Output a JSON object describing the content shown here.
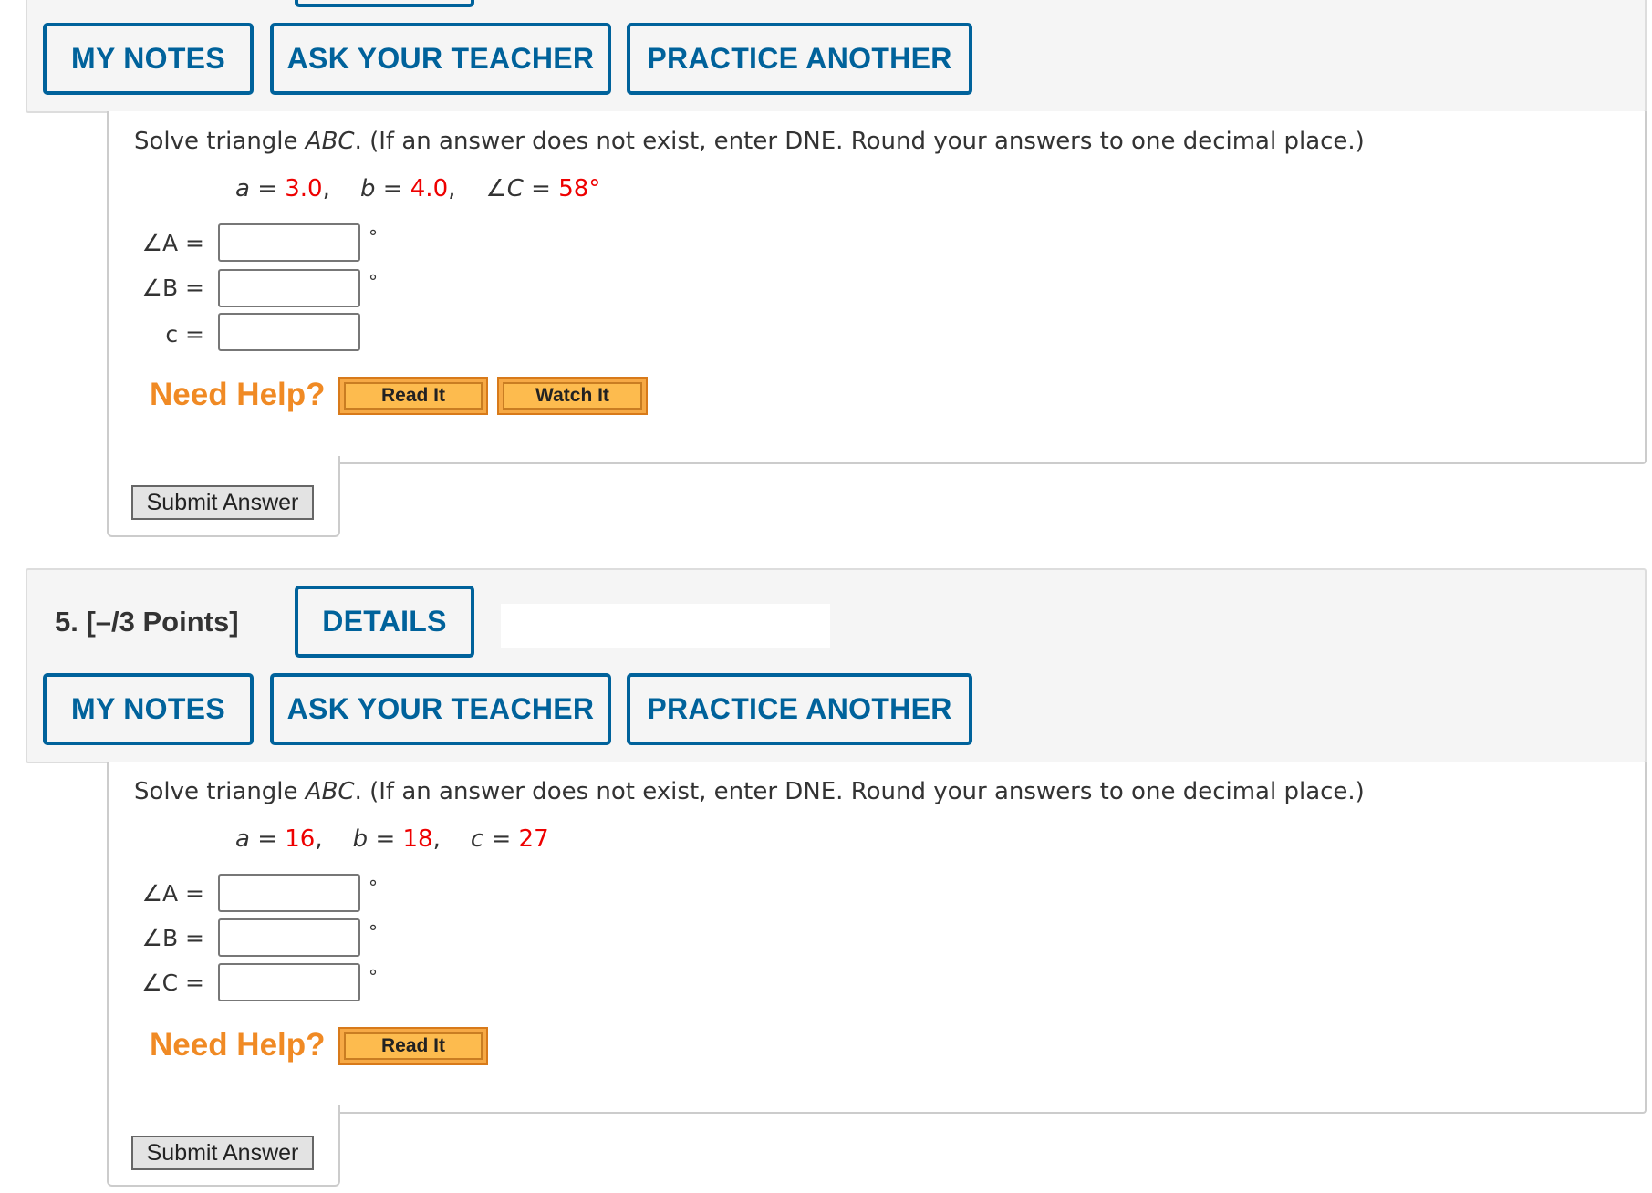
{
  "buttons": {
    "my_notes": "MY NOTES",
    "ask_teacher": "ASK YOUR TEACHER",
    "practice_another": "PRACTICE ANOTHER",
    "details": "DETAILS",
    "submit": "Submit Answer",
    "read_it": "Read It",
    "watch_it": "Watch It",
    "need_help": "Need Help?"
  },
  "q4": {
    "instruction_pre": "Solve triangle ",
    "instruction_abc": "ABC",
    "instruction_post": ". (If an answer does not exist, enter DNE. Round your answers to one decimal place.)",
    "given": [
      {
        "label": "a = ",
        "value": "3.0",
        "sep": ","
      },
      {
        "label": "b = ",
        "value": "4.0",
        "sep": ","
      },
      {
        "label": "∠C = ",
        "value": "58°",
        "sep": ""
      }
    ],
    "answers": [
      {
        "label": "∠A =",
        "unit": "°",
        "value": ""
      },
      {
        "label": "∠B =",
        "unit": "°",
        "value": ""
      },
      {
        "label": "c =",
        "unit": "",
        "value": ""
      }
    ]
  },
  "q5": {
    "title": "5.  [–/3 Points]",
    "instruction_pre": "Solve triangle ",
    "instruction_abc": "ABC",
    "instruction_post": ". (If an answer does not exist, enter DNE. Round your answers to one decimal place.)",
    "given": [
      {
        "label": "a = ",
        "value": "16",
        "sep": ","
      },
      {
        "label": "b = ",
        "value": "18",
        "sep": ","
      },
      {
        "label": "c = ",
        "value": "27",
        "sep": ""
      }
    ],
    "answers": [
      {
        "label": "∠A =",
        "unit": "°",
        "value": ""
      },
      {
        "label": "∠B =",
        "unit": "°",
        "value": ""
      },
      {
        "label": "∠C =",
        "unit": "°",
        "value": ""
      }
    ]
  }
}
